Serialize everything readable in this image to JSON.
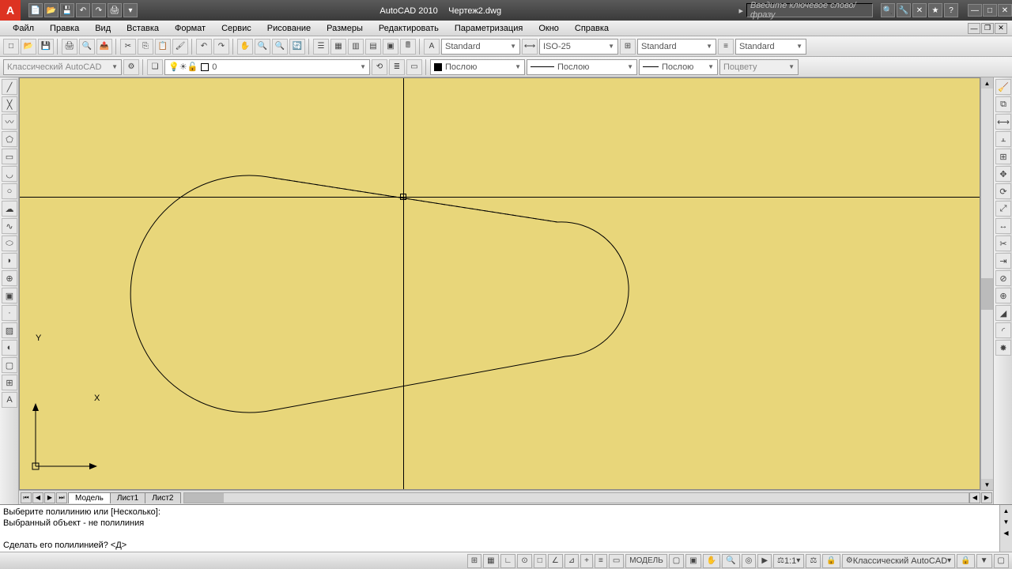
{
  "title": {
    "app": "AutoCAD 2010",
    "doc": "Чертеж2.dwg"
  },
  "search": {
    "placeholder": "Введите ключевое слово/фразу"
  },
  "menu": [
    "Файл",
    "Правка",
    "Вид",
    "Вставка",
    "Формат",
    "Сервис",
    "Рисование",
    "Размеры",
    "Редактировать",
    "Параметризация",
    "Окно",
    "Справка"
  ],
  "toolbar2": {
    "styleTextCombo": "Standard",
    "dimCombo": "ISO-25",
    "tableCombo": "Standard",
    "mlCombo": "Standard"
  },
  "toolbar3": {
    "workspaceCombo": "Классический AutoCAD",
    "layerCombo": "0",
    "colorCombo": "Послою",
    "ltypeCombo": "Послою",
    "lweightCombo": "Послою",
    "pstyleCombo": "Поцвету"
  },
  "tabs": {
    "active": "Модель",
    "others": [
      "Лист1",
      "Лист2"
    ]
  },
  "cmd": {
    "line1": "Выберите полилинию или [Несколько]:",
    "line2": "Выбранный объект - не полилиния",
    "line3": "Сделать его полилинией? <Д>"
  },
  "status": {
    "model": "МОДЕЛЬ",
    "scale": "1:1",
    "ws": "Классический AutoCAD"
  },
  "ucs": {
    "x": "X",
    "y": "Y"
  }
}
